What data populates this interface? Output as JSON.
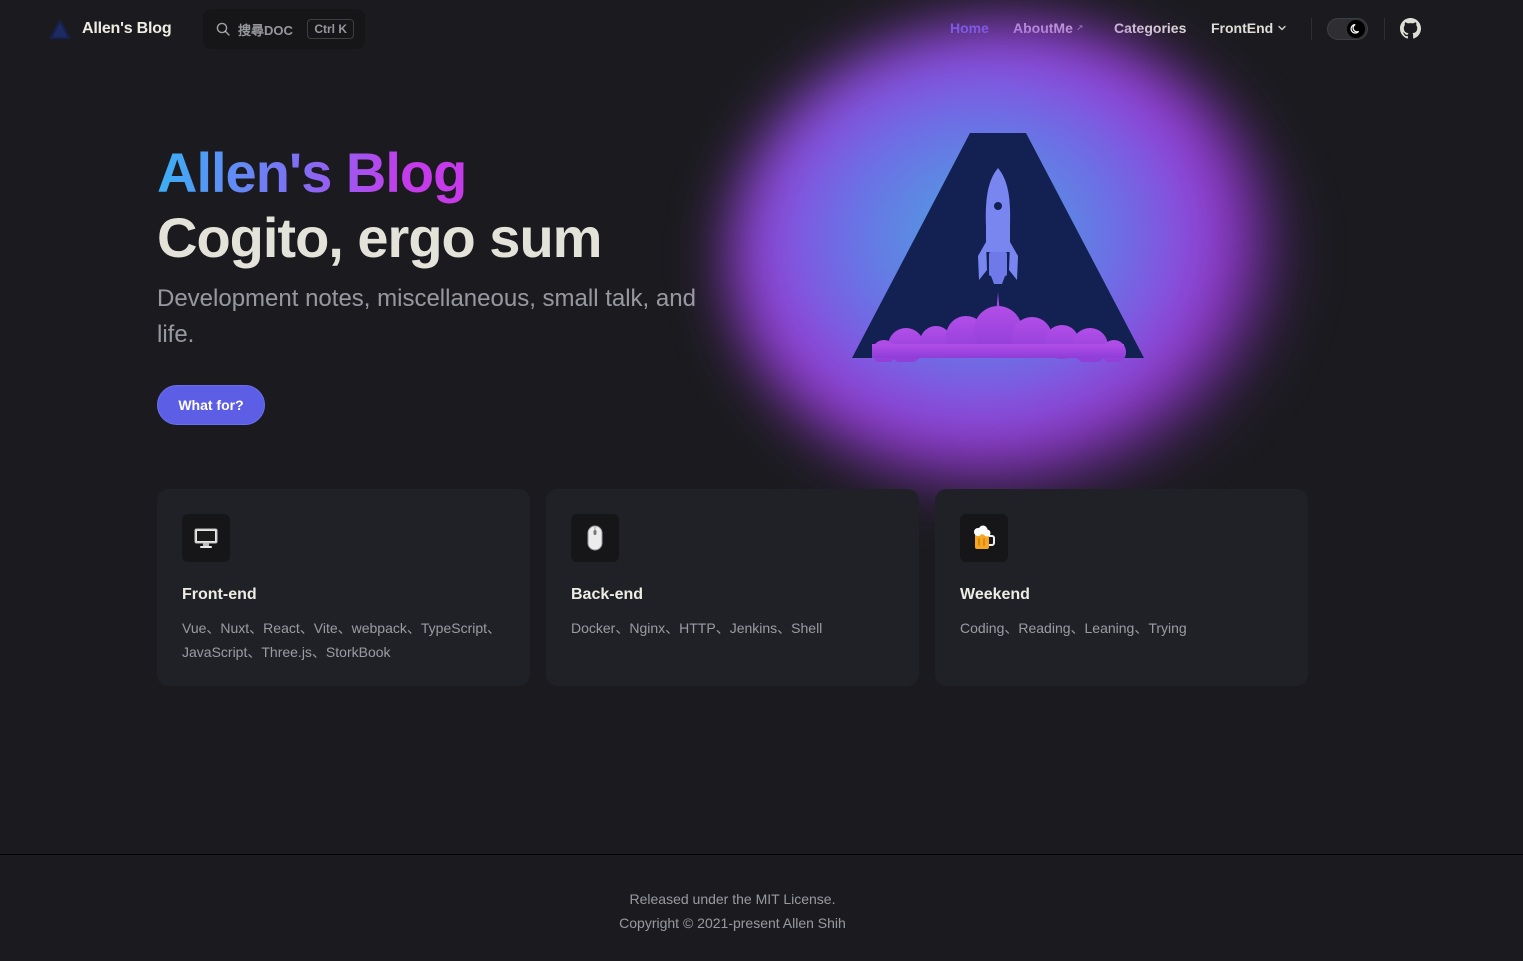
{
  "nav": {
    "brand_title": "Allen's Blog",
    "search_placeholder": "搜尋DOC",
    "search_shortcut": "Ctrl K",
    "items": [
      {
        "label": "Home",
        "active": true
      },
      {
        "label": "AboutMe",
        "external": true
      },
      {
        "label": "Categories"
      },
      {
        "label": "FrontEnd",
        "dropdown": true
      }
    ],
    "theme": "dark",
    "icons": {
      "logo": "triangle-logo-icon",
      "search": "search-icon",
      "theme": "moon-icon",
      "social": "github-icon"
    }
  },
  "hero": {
    "name": "Allen's Blog",
    "text": "Cogito, ergo sum",
    "tagline": "Development notes, miscellaneous, small talk, and life.",
    "action_label": "What for?",
    "image": "rocket-launch-logo"
  },
  "features": [
    {
      "icon": "monitor-icon",
      "title": "Front-end",
      "details": "Vue、Nuxt、React、Vite、webpack、TypeScript、JavaScript、Three.js、StorkBook"
    },
    {
      "icon": "mouse-icon",
      "title": "Back-end",
      "details": "Docker、Nginx、HTTP、Jenkins、Shell"
    },
    {
      "icon": "beer-mug-icon",
      "title": "Weekend",
      "details": "Coding、Reading、Leaning、Trying"
    }
  ],
  "footer": {
    "message": "Released under the MIT License.",
    "copyright": "Copyright © 2021-present Allen Shih"
  },
  "colors": {
    "background": "#1b1b1f",
    "brand": "#5c5fe6",
    "card": "#202127",
    "active_link": "#6b72f0"
  }
}
